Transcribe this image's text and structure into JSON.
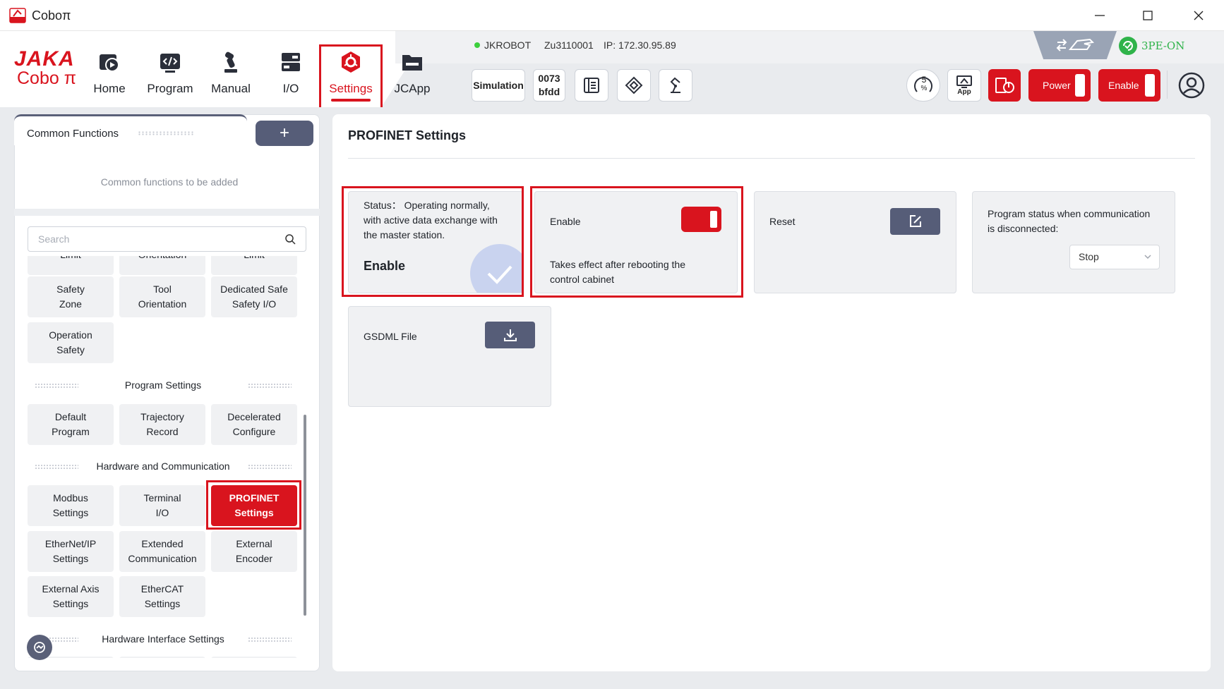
{
  "window": {
    "title": "Coboπ"
  },
  "logo": {
    "text_top": "JAKA",
    "text_bottom": "Cobo π"
  },
  "nav": [
    {
      "label": "Home",
      "icon": "home-icon"
    },
    {
      "label": "Program",
      "icon": "code-icon"
    },
    {
      "label": "Manual",
      "icon": "robot-arm-icon"
    },
    {
      "label": "I/O",
      "icon": "io-icon"
    },
    {
      "label": "Settings",
      "icon": "settings-hex-icon",
      "active": true
    },
    {
      "label": "JCApp",
      "icon": "folder-icon"
    }
  ],
  "status": {
    "robot_name": "JKROBOT",
    "model": "Zu3110001",
    "ip": "IP: 172.30.95.89",
    "threepe": "3PE-ON"
  },
  "toolbar": {
    "simulation": "Simulation",
    "code_line1": "0073",
    "code_line2": "bfdd",
    "speed": "5",
    "speed_unit": "%",
    "app": "App",
    "power": "Power",
    "enable": "Enable"
  },
  "common_functions": {
    "title": "Common Functions",
    "add": "+",
    "empty_text": "Common functions to be added"
  },
  "search": {
    "placeholder": "Search"
  },
  "menu": {
    "row0": [
      "Limit",
      "Orientation",
      "Limit"
    ],
    "safety_row1": [
      "Safety\nZone",
      "Tool\nOrientation",
      "Dedicated Safe\nSafety I/O"
    ],
    "safety_row2": [
      "Operation\nSafety"
    ],
    "program_section": "Program Settings",
    "program_items": [
      "Default\nProgram",
      "Trajectory\nRecord",
      "Decelerated\nConfigure"
    ],
    "hardware_section": "Hardware and Communication",
    "hardware_row1": [
      "Modbus\nSettings",
      "Terminal\nI/O",
      "PROFINET\nSettings"
    ],
    "hardware_row2": [
      "EtherNet/IP\nSettings",
      "Extended\nCommunication",
      "External\nEncoder"
    ],
    "hardware_row3": [
      "External Axis\nSettings",
      "EtherCAT\nSettings"
    ],
    "interface_section": "Hardware Interface Settings"
  },
  "page": {
    "title": "PROFINET Settings",
    "status_card": {
      "label": "Status： Operating normally,",
      "line2": "with active data exchange with",
      "line3": "the master station.",
      "state": "Enable"
    },
    "enable_card": {
      "label": "Enable",
      "enabled": true,
      "note_line1": "Takes effect after rebooting the",
      "note_line2": "control cabinet"
    },
    "reset_card": {
      "label": "Reset"
    },
    "disconnect_card": {
      "label_line1": "Program status when communication",
      "label_line2": "is disconnected:",
      "value": "Stop"
    },
    "gsdml_card": {
      "label": "GSDML File"
    }
  },
  "colors": {
    "accent": "#d9141e",
    "button_dark": "#565d78",
    "card_bg": "#f0f1f3",
    "ok_green": "#2fb34a"
  }
}
